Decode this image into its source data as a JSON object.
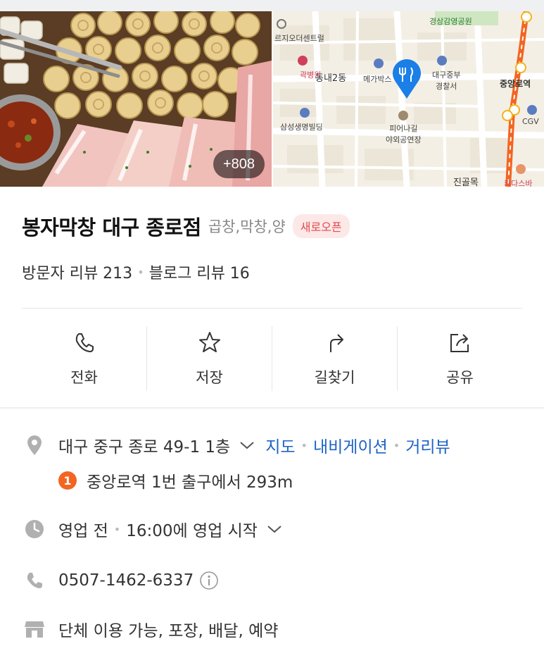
{
  "hero": {
    "photo_count": "+808",
    "map": {
      "labels": {
        "park": "경상감영공원",
        "center": "르지오더센트럴",
        "hospital": "곽병원",
        "dong": "동내2동",
        "megabox": "메가박스",
        "police": "대구중부\n경찰서",
        "station": "중앙로역",
        "samsung": "삼성생명빌딩",
        "venue": "피어나길\n야외공연장",
        "cgv": "CGV",
        "alley": "진골목",
        "kakao": "카다스바"
      },
      "subway_line_color": "#f26522",
      "pin_color": "#1a7fe6"
    }
  },
  "place": {
    "name": "봉자막창 대구 종로점",
    "category": "곱창,막창,양",
    "badge": "새로오픈",
    "visitor_reviews": "방문자 리뷰 213",
    "blog_reviews": "블로그 리뷰 16"
  },
  "actions": [
    {
      "label": "전화",
      "icon": "phone-icon"
    },
    {
      "label": "저장",
      "icon": "star-icon"
    },
    {
      "label": "길찾기",
      "icon": "directions-icon"
    },
    {
      "label": "공유",
      "icon": "share-icon"
    }
  ],
  "info": {
    "address": "대구 중구 종로 49-1 1층",
    "map_link": "지도",
    "navigation_link": "내비게이션",
    "streetview_link": "거리뷰",
    "subway_exit_number": "1",
    "subway_text": "중앙로역 1번 출구에서 293m",
    "status": "영업 전",
    "hours_text": "16:00에 영업 시작",
    "phone": "0507-1462-6337",
    "facilities": "단체 이용 가능, 포장, 배달, 예약"
  },
  "colors": {
    "link": "#1e63c4",
    "badge_text": "#e24b4b",
    "badge_bg": "#fde8e8",
    "icon_gray": "#b0b0b0"
  }
}
